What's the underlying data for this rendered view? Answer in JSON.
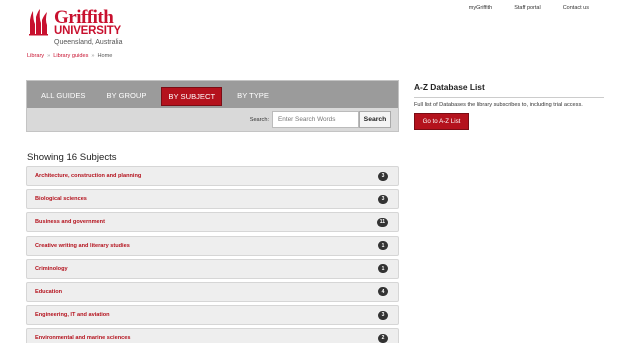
{
  "logo": {
    "name": "Griffith",
    "university": "UNIVERSITY",
    "location": "Queensland, Australia",
    "brand_color": "#c8102e"
  },
  "topnav": [
    "myGriffith",
    "Staff portal",
    "Contact us"
  ],
  "breadcrumb": {
    "items": [
      "Library",
      "Library guides",
      "Home"
    ],
    "separator": "»"
  },
  "tabs": [
    {
      "label": "ALL GUIDES",
      "active": false
    },
    {
      "label": "BY GROUP",
      "active": false
    },
    {
      "label": "BY SUBJECT",
      "active": true
    },
    {
      "label": "BY TYPE",
      "active": false
    }
  ],
  "search": {
    "label": "Search:",
    "placeholder": "Enter Search Words",
    "button": "Search"
  },
  "az": {
    "title": "A-Z Database List",
    "description": "Full list of Databases the library subscribes to, including trial access.",
    "button": "Go to A-Z List"
  },
  "subjects": {
    "heading": "Showing 16 Subjects",
    "items": [
      {
        "name": "Architecture, construction and planning",
        "count": "3"
      },
      {
        "name": "Biological sciences",
        "count": "3"
      },
      {
        "name": "Business and government",
        "count": "11"
      },
      {
        "name": "Creative writing and literary studies",
        "count": "1"
      },
      {
        "name": "Criminology",
        "count": "1"
      },
      {
        "name": "Education",
        "count": "4"
      },
      {
        "name": "Engineering, IT and aviation",
        "count": "3"
      },
      {
        "name": "Environmental and marine sciences",
        "count": "2"
      }
    ]
  }
}
